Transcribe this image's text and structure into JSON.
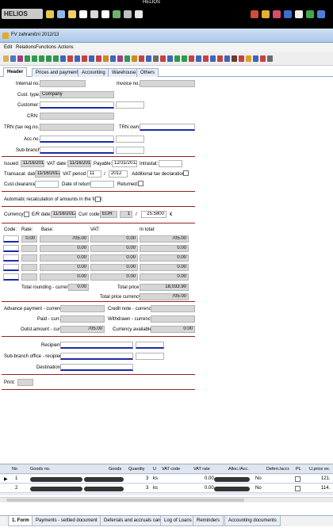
{
  "app": {
    "title": "HELIOS",
    "logo": "HELIOS"
  },
  "window": {
    "title": "FV zahraniční 2012/13"
  },
  "menu": [
    "Edit",
    "Relations",
    "Functions",
    "Actions"
  ],
  "tabs": [
    "Header",
    "Prices and payments",
    "Accounting",
    "Warehouse",
    "Others"
  ],
  "header": {
    "internal_no_label": "Internal no.:",
    "invoice_no_label": "Invoice no.:",
    "cust_type_label": "Cust. type.:",
    "cust_type_value": "Company",
    "customer_label": "Customer:",
    "crn_label": "CRN:",
    "trn_label": "TRN (tax reg.no.):",
    "trn_own_label": "TRN own:",
    "acc_no_label": "Acc.no.:",
    "sub_branch_label": "Sub-branch:",
    "issued_label": "Issued:",
    "issued_value": "11/16/2012",
    "vat_date_label": "VAT date:",
    "vat_date_value": "11/16/2012",
    "payable_label": "Payable:",
    "payable_value": "12/31/2012",
    "intrastat_label": "Intrastat:",
    "transacat_date_label": "Transacat. date:",
    "transacat_date_value": "11/16/2012",
    "vat_period_label": "VAT period:",
    "vat_period_month": "11",
    "vat_period_sep": "/",
    "vat_period_year": "2012",
    "additional_tax_label": "Additional tax declaration:",
    "cust_clearance_label": "Cust.clearance:",
    "date_of_return_label": "Date of return:",
    "returned_label": "Returned:",
    "auto_recalc_label": "Automatic recalculation of amounts in the form:",
    "currency_label": "Currency:",
    "er_date_label": "E/R date:",
    "er_date_value": "11/16/2012",
    "curr_code_label": "Curr code:",
    "curr_code_value": "EUR",
    "rate_unit": "1",
    "rate_sep": "/",
    "rate_value": "25.5800",
    "rate_currency": "€"
  },
  "vat_table": {
    "headers": [
      "Code:",
      "Rate:",
      "Base:",
      "VAT:",
      "In total:"
    ],
    "rows": [
      {
        "rate": "0.00",
        "base": "705.00",
        "vat": "0.00",
        "total": "705.00"
      },
      {
        "rate": "",
        "base": "0.00",
        "vat": "0.00",
        "total": "0.00"
      },
      {
        "rate": "",
        "base": "0.00",
        "vat": "0.00",
        "total": "0.00"
      },
      {
        "rate": "",
        "base": "0.00",
        "vat": "0.00",
        "total": "0.00"
      },
      {
        "rate": "",
        "base": "0.00",
        "vat": "0.00",
        "total": "0.00"
      }
    ],
    "total_rounding_label": "Total rounding - currency:",
    "total_rounding_value": "0.00",
    "total_price_label": "Total price:",
    "total_price_value": "18,033.90",
    "total_price_currency_label": "Total price currency:",
    "total_price_currency_value": "705.00"
  },
  "payments": {
    "advance_label": "Advance payment - currency:",
    "credit_note_label": "Credit note - currency:",
    "paid_label": "Paid - curr.:",
    "withdrawn_label": "Withdrawn - currency:",
    "outst_label": "Outst.amount - curr.:",
    "outst_value": "705.00",
    "currency_available_label": "Currency available:",
    "currency_available_value": "0.00"
  },
  "recipient": {
    "recipient_label": "Recipient:",
    "sub_branch_label": "Sub-branch office - recipient:",
    "destination_label": "Destination:"
  },
  "print_label": "Print:",
  "grid": {
    "headers": [
      "No",
      "Goods no.",
      "Goods",
      "Quantity",
      "U",
      "VAT code",
      "VAT rate",
      "Alloc./Acc.",
      "Deferr./accr.",
      "PL",
      "U.price ex."
    ],
    "rows": [
      {
        "no": "1",
        "quantity": "3",
        "unit": "ks",
        "vat_rate": "0.00",
        "alloc": "No",
        "price": "121."
      },
      {
        "no": "2",
        "quantity": "3",
        "unit": "ks",
        "vat_rate": "0.00",
        "alloc": "No",
        "price": "114."
      }
    ]
  },
  "bottom_tabs": [
    "1. Form",
    "Payments - settled document",
    "Deferrals and accruals card",
    "Log of Loans",
    "Reminders",
    "Accounting documents"
  ],
  "colors": {
    "accent_blue": "#1c2aa8",
    "separator_red": "#9b2020",
    "tab_blue": "#e6edf6"
  }
}
